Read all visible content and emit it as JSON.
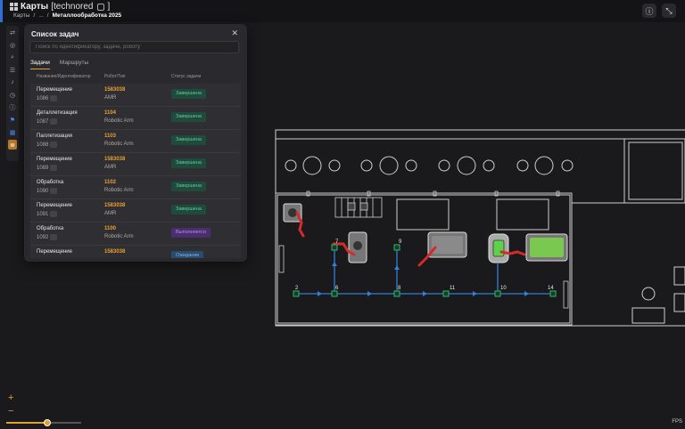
{
  "header": {
    "title": "Карты",
    "org": "[technored",
    "org_close": "]",
    "breadcrumb": [
      "Карты",
      "/",
      "...",
      "/",
      "Металлообработка 2025"
    ]
  },
  "panel": {
    "title": "Список задач",
    "search_placeholder": "Поиск по идентификатору, задаче, роботу",
    "tabs": [
      "Задачи",
      "Маршруты"
    ],
    "columns": [
      "Название/Идентификатор",
      "Робот/Тип",
      "Статус задачи"
    ],
    "rows": [
      {
        "name": "Перемещение",
        "id": "1086",
        "robot": "1583038",
        "type": "AMR",
        "status": "Завершена",
        "status_kind": "done"
      },
      {
        "name": "Деталлетизация",
        "id": "1087",
        "robot": "1104",
        "type": "Robotic Arm",
        "status": "Завершена",
        "status_kind": "done"
      },
      {
        "name": "Паллетизация",
        "id": "1088",
        "robot": "1103",
        "type": "Robotic Arm",
        "status": "Завершена",
        "status_kind": "done"
      },
      {
        "name": "Перемещение",
        "id": "1089",
        "robot": "1583038",
        "type": "AMR",
        "status": "Завершена",
        "status_kind": "done"
      },
      {
        "name": "Обработка",
        "id": "1090",
        "robot": "1102",
        "type": "Robotic Arm",
        "status": "Завершена",
        "status_kind": "done"
      },
      {
        "name": "Перемещение",
        "id": "1091",
        "robot": "1583038",
        "type": "AMR",
        "status": "Завершена",
        "status_kind": "done"
      },
      {
        "name": "Обработка",
        "id": "1092",
        "robot": "1100",
        "type": "Robotic Arm",
        "status": "Выполняется",
        "status_kind": "run"
      },
      {
        "name": "Перемещение",
        "id": "",
        "robot": "1583038",
        "type": "",
        "status": "Ожидание",
        "status_kind": "wait"
      }
    ]
  },
  "map": {
    "nodes": [
      "2",
      "6",
      "7",
      "8",
      "9",
      "10",
      "11",
      "14"
    ]
  },
  "zoom": {
    "plus": "+",
    "minus": "−",
    "level": 0.55
  },
  "fps_label": "FPS",
  "colors": {
    "accent": "#e0a030",
    "route": "#2f7fd6",
    "arm": "#d42a2a",
    "node": "#2fb86a"
  }
}
